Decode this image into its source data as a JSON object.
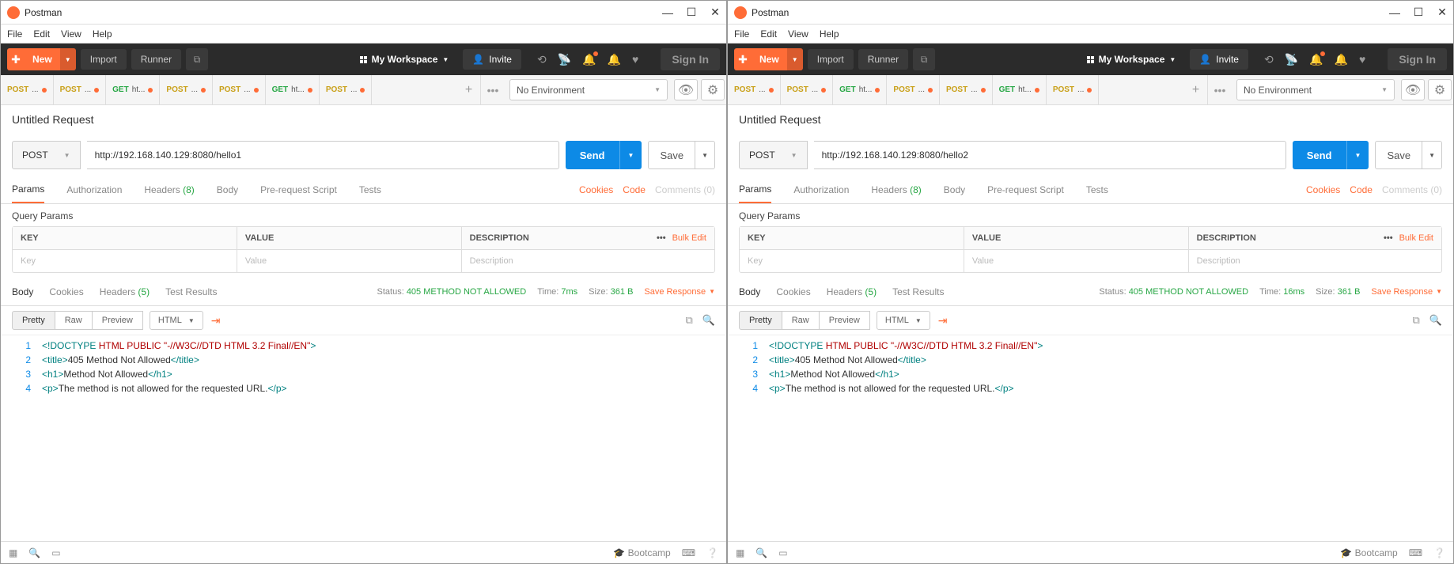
{
  "app_title": "Postman",
  "menu": [
    "File",
    "Edit",
    "View",
    "Help"
  ],
  "toolbar": {
    "new": "New",
    "import": "Import",
    "runner": "Runner",
    "workspace": "My Workspace",
    "invite": "Invite",
    "signin": "Sign In"
  },
  "tabs_labels": {
    "post": "POST",
    "get": "GET",
    "body": "..."
  },
  "tab_methods": [
    "POST",
    "POST",
    "GET",
    "POST",
    "POST",
    "GET",
    "POST"
  ],
  "tab_names": [
    "...",
    "...",
    "ht...",
    "...",
    "...",
    "ht...",
    "..."
  ],
  "env": "No Environment",
  "request_title": "Untitled Request",
  "method": "POST",
  "urls": [
    "http://192.168.140.129:8080/hello1",
    "http://192.168.140.129:8080/hello2"
  ],
  "send": "Send",
  "save": "Save",
  "subtabs": {
    "params": "Params",
    "auth": "Authorization",
    "headers": "Headers",
    "headers_count": "(8)",
    "body": "Body",
    "pre": "Pre-request Script",
    "tests": "Tests",
    "cookies": "Cookies",
    "code": "Code",
    "comments": "Comments (0)"
  },
  "query_params_title": "Query Params",
  "table": {
    "key": "KEY",
    "value": "VALUE",
    "desc": "DESCRIPTION",
    "ph_key": "Key",
    "ph_val": "Value",
    "ph_desc": "Description",
    "bulk": "Bulk Edit"
  },
  "resp": {
    "body": "Body",
    "cookies": "Cookies",
    "headers": "Headers",
    "headers_count": "(5)",
    "test": "Test Results",
    "status_lbl": "Status:",
    "status": "405 METHOD NOT ALLOWED",
    "time_lbl": "Time:",
    "time": [
      "7ms",
      "16ms"
    ],
    "size_lbl": "Size:",
    "size": "361 B",
    "save": "Save Response"
  },
  "fmt": {
    "pretty": "Pretty",
    "raw": "Raw",
    "preview": "Preview",
    "lang": "HTML"
  },
  "code_lines": [
    {
      "n": 1,
      "pre": "<!DOCTYPE",
      "mid": " HTML PUBLIC \"-//W3C//DTD HTML 3.2 Final//EN\"",
      "post": ">"
    },
    {
      "n": 2,
      "pre": "<title>",
      "mid": "405 Method Not Allowed",
      "post": "</title>"
    },
    {
      "n": 3,
      "pre": "<h1>",
      "mid": "Method Not Allowed",
      "post": "</h1>"
    },
    {
      "n": 4,
      "pre": "<p>",
      "mid": "The method is not allowed for the requested URL.",
      "post": "</p>"
    }
  ],
  "bootcamp": "Bootcamp"
}
